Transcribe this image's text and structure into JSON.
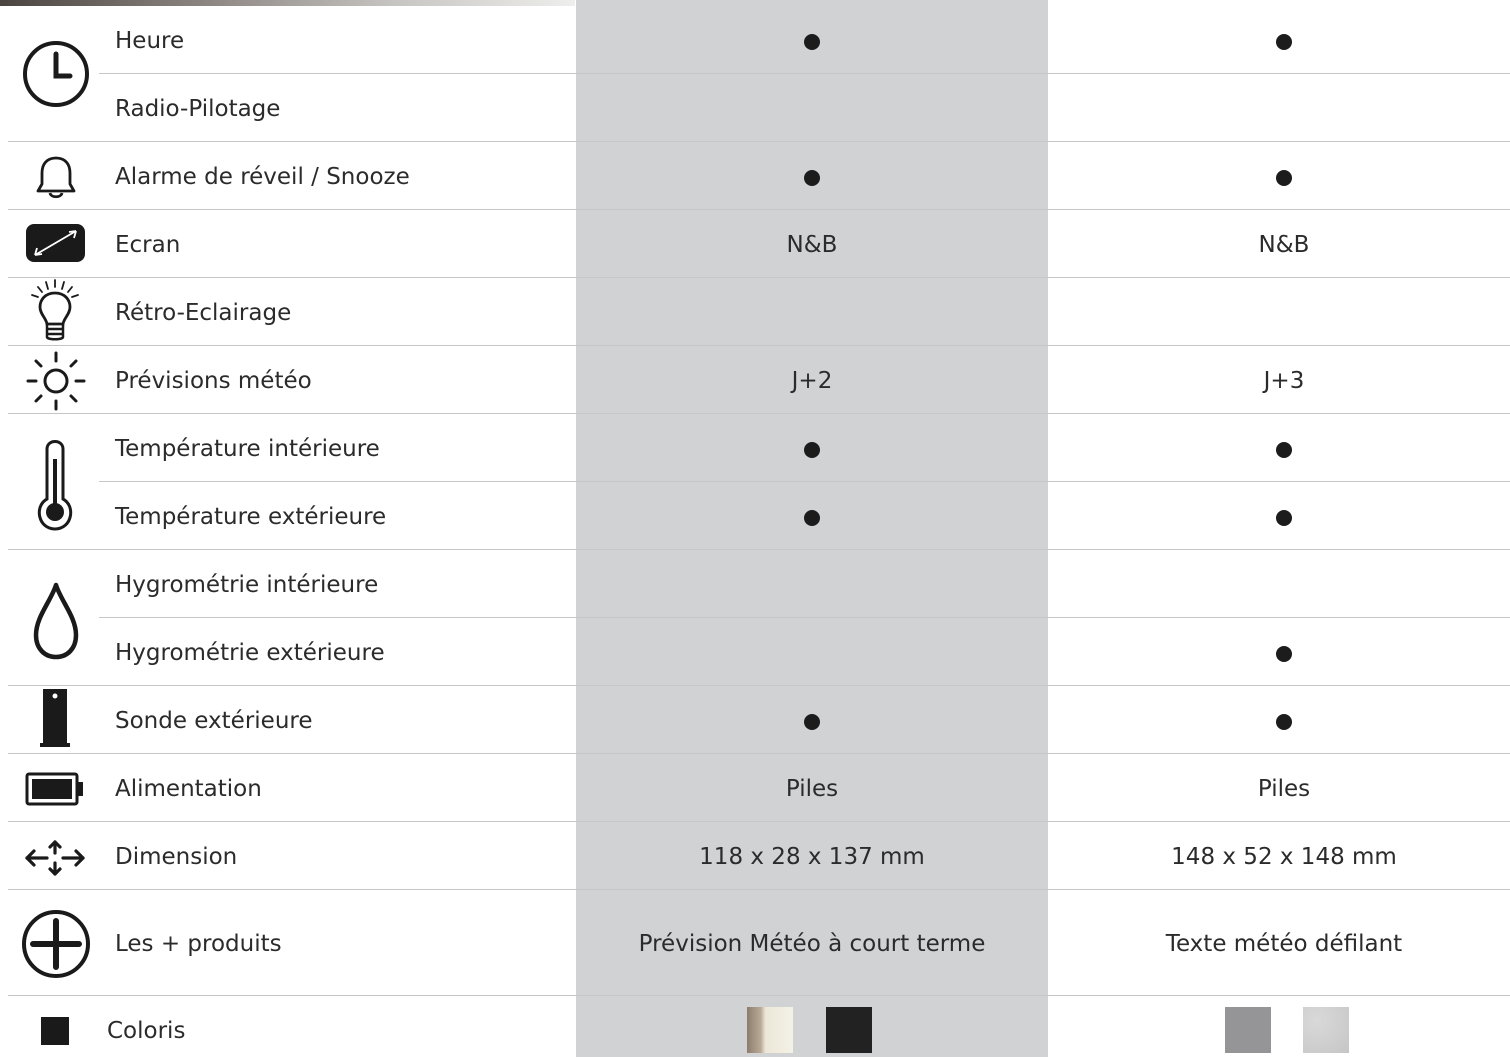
{
  "rows": [
    {
      "label": "Heure",
      "icon": "clock-icon",
      "a": "dot",
      "b": "dot"
    },
    {
      "label": "Radio-Pilotage",
      "icon": "",
      "a": "",
      "b": ""
    },
    {
      "label": "Alarme de réveil / Snooze",
      "icon": "bell-icon",
      "a": "dot",
      "b": "dot"
    },
    {
      "label": "Ecran",
      "icon": "screen-icon",
      "a": "N&B",
      "b": "N&B"
    },
    {
      "label": "Rétro-Eclairage",
      "icon": "lightbulb-icon",
      "a": "",
      "b": ""
    },
    {
      "label": "Prévisions météo",
      "icon": "sun-icon",
      "a": "J+2",
      "b": "J+3"
    },
    {
      "label": "Température intérieure",
      "icon": "thermometer-icon",
      "a": "dot",
      "b": "dot"
    },
    {
      "label": "Température extérieure",
      "icon": "",
      "a": "dot",
      "b": "dot"
    },
    {
      "label": "Hygrométrie intérieure",
      "icon": "droplet-icon",
      "a": "",
      "b": ""
    },
    {
      "label": "Hygrométrie extérieure",
      "icon": "",
      "a": "",
      "b": "dot"
    },
    {
      "label": "Sonde extérieure",
      "icon": "sensor-icon",
      "a": "dot",
      "b": "dot"
    },
    {
      "label": "Alimentation",
      "icon": "battery-icon",
      "a": "Piles",
      "b": "Piles"
    },
    {
      "label": "Dimension",
      "icon": "dimension-arrows-icon",
      "a": "118 x 28 x 137 mm",
      "b": "148 x 52 x 148 mm"
    },
    {
      "label": "Les + produits",
      "icon": "plus-circle-icon",
      "a": "Prévision Météo à court terme",
      "b": "Texte météo défilant"
    }
  ],
  "coloris": {
    "label": "Coloris",
    "icon": "square-icon",
    "a_swatches": [
      {
        "name": "wood-cream",
        "colors": [
          "#8c7d6e",
          "#b9aa97",
          "#ece7d8",
          "#f4f1e6"
        ]
      },
      {
        "name": "black",
        "colors": [
          "#222222"
        ]
      }
    ],
    "b_swatches": [
      {
        "name": "grey",
        "colors": [
          "#959597"
        ]
      },
      {
        "name": "silver-texture",
        "colors": [
          "#d9d9d9",
          "#c6c6c6"
        ]
      }
    ]
  },
  "colors": {
    "highlight_column": "#d1d2d4",
    "rule": "#c6c6c6",
    "dot": "#1c1c1c"
  }
}
